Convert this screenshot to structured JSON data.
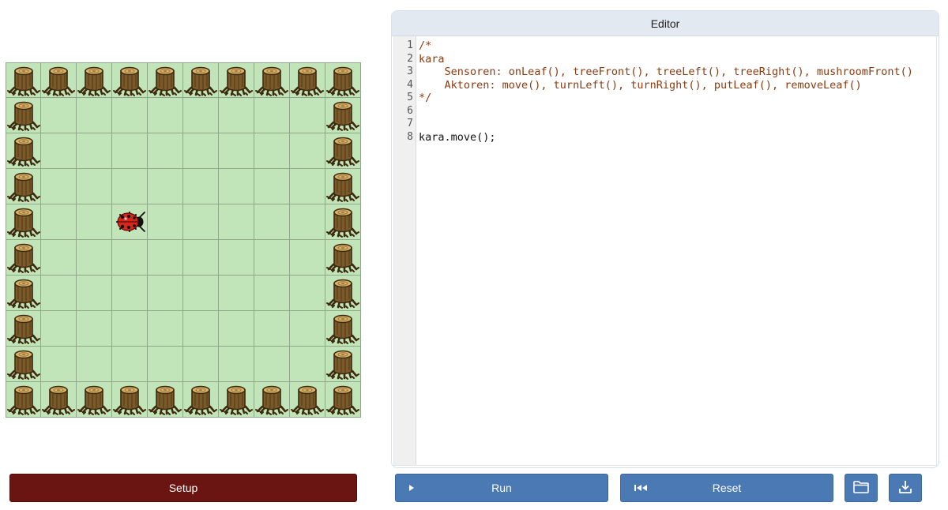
{
  "world": {
    "rows": 10,
    "cols": 10,
    "trees": [
      [
        0,
        0
      ],
      [
        0,
        1
      ],
      [
        0,
        2
      ],
      [
        0,
        3
      ],
      [
        0,
        4
      ],
      [
        0,
        5
      ],
      [
        0,
        6
      ],
      [
        0,
        7
      ],
      [
        0,
        8
      ],
      [
        0,
        9
      ],
      [
        1,
        0
      ],
      [
        1,
        9
      ],
      [
        2,
        0
      ],
      [
        2,
        9
      ],
      [
        3,
        0
      ],
      [
        3,
        9
      ],
      [
        4,
        0
      ],
      [
        4,
        9
      ],
      [
        5,
        0
      ],
      [
        5,
        9
      ],
      [
        6,
        0
      ],
      [
        6,
        9
      ],
      [
        7,
        0
      ],
      [
        7,
        9
      ],
      [
        8,
        0
      ],
      [
        8,
        9
      ],
      [
        9,
        0
      ],
      [
        9,
        1
      ],
      [
        9,
        2
      ],
      [
        9,
        3
      ],
      [
        9,
        4
      ],
      [
        9,
        5
      ],
      [
        9,
        6
      ],
      [
        9,
        7
      ],
      [
        9,
        8
      ],
      [
        9,
        9
      ]
    ],
    "kara": {
      "row": 4,
      "col": 3,
      "direction": "right"
    },
    "colors": {
      "grass": "#c1e4b9",
      "grid": "#8fa88b"
    }
  },
  "setup": {
    "label": "Setup"
  },
  "editor": {
    "title": "Editor",
    "lines": [
      {
        "num": "1",
        "text": "/*",
        "kind": "comment"
      },
      {
        "num": "2",
        "text": "kara",
        "kind": "comment"
      },
      {
        "num": "3",
        "text": "    Sensoren: onLeaf(), treeFront(), treeLeft(), treeRight(), mushroomFront()",
        "kind": "comment"
      },
      {
        "num": "4",
        "text": "    Aktoren: move(), turnLeft(), turnRight(), putLeaf(), removeLeaf()",
        "kind": "comment"
      },
      {
        "num": "5",
        "text": "*/",
        "kind": "comment"
      },
      {
        "num": "6",
        "text": "",
        "kind": "code"
      },
      {
        "num": "7",
        "text": "",
        "kind": "code"
      },
      {
        "num": "8",
        "text": "kara.move();",
        "kind": "code"
      }
    ]
  },
  "toolbar": {
    "run_label": "Run",
    "reset_label": "Reset",
    "run_icon": "play-icon",
    "reset_icon": "skip-back-icon",
    "open_icon": "folder-icon",
    "download_icon": "download-icon",
    "colors": {
      "button": "#4a79b4",
      "setup": "#6b1512"
    }
  }
}
